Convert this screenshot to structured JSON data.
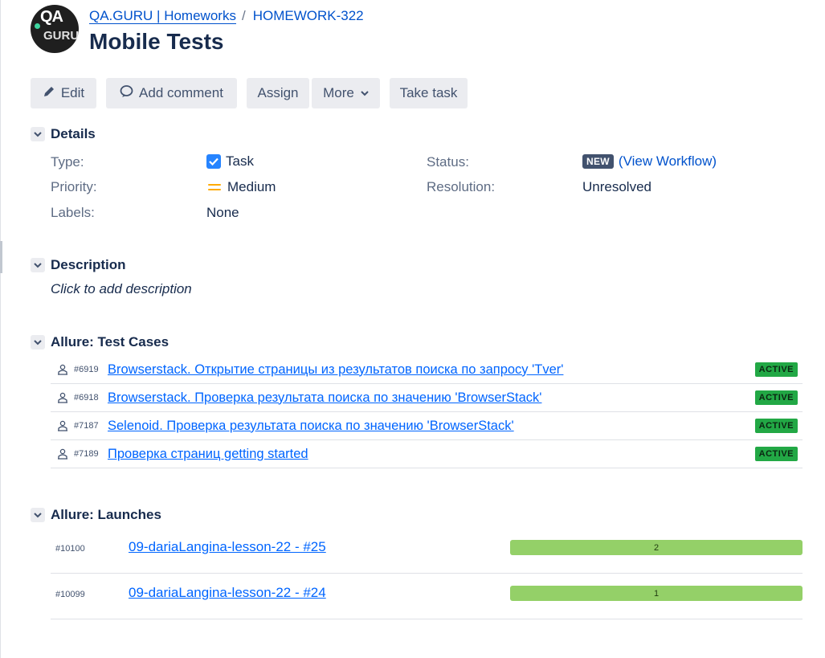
{
  "header": {
    "breadcrumb_project": "QA.GURU | Homeworks",
    "breadcrumb_separator": "/",
    "breadcrumb_issue": "HOMEWORK-322",
    "title": "Mobile Tests",
    "avatar_text_top": "QA",
    "avatar_text_bottom": "GURU"
  },
  "toolbar": {
    "edit": "Edit",
    "add_comment": "Add comment",
    "assign": "Assign",
    "more": "More",
    "take_task": "Take task"
  },
  "details": {
    "title": "Details",
    "type_label": "Type:",
    "type_value": "Task",
    "priority_label": "Priority:",
    "priority_value": "Medium",
    "labels_label": "Labels:",
    "labels_value": "None",
    "status_label": "Status:",
    "status_value": "NEW",
    "view_workflow": "(View Workflow)",
    "resolution_label": "Resolution:",
    "resolution_value": "Unresolved"
  },
  "description": {
    "title": "Description",
    "placeholder": "Click to add description"
  },
  "test_cases": {
    "title": "Allure: Test Cases",
    "items": [
      {
        "id": "#6919",
        "name": "Browserstack. Открытие страницы из результатов поиска по запросу 'Tver'",
        "status": "ACTIVE"
      },
      {
        "id": "#6918",
        "name": "Browserstack. Проверка результата поиска по значению 'BrowserStack'",
        "status": "ACTIVE"
      },
      {
        "id": "#7187",
        "name": "Selenoid. Проверка результата поиска по значению 'BrowserStack'",
        "status": "ACTIVE"
      },
      {
        "id": "#7189",
        "name": "Проверка страниц getting started",
        "status": "ACTIVE"
      }
    ]
  },
  "launches": {
    "title": "Allure: Launches",
    "items": [
      {
        "id": "#10100",
        "name": "09-dariaLangina-lesson-22 - #25",
        "count": "2"
      },
      {
        "id": "#10099",
        "name": "09-dariaLangina-lesson-22 - #24",
        "count": "1"
      }
    ]
  },
  "colors": {
    "link": "#0052cc",
    "active_badge": "#22a845",
    "launch_bar": "#94d068",
    "status_lozenge": "#42526e",
    "priority_medium": "#ffab00"
  }
}
